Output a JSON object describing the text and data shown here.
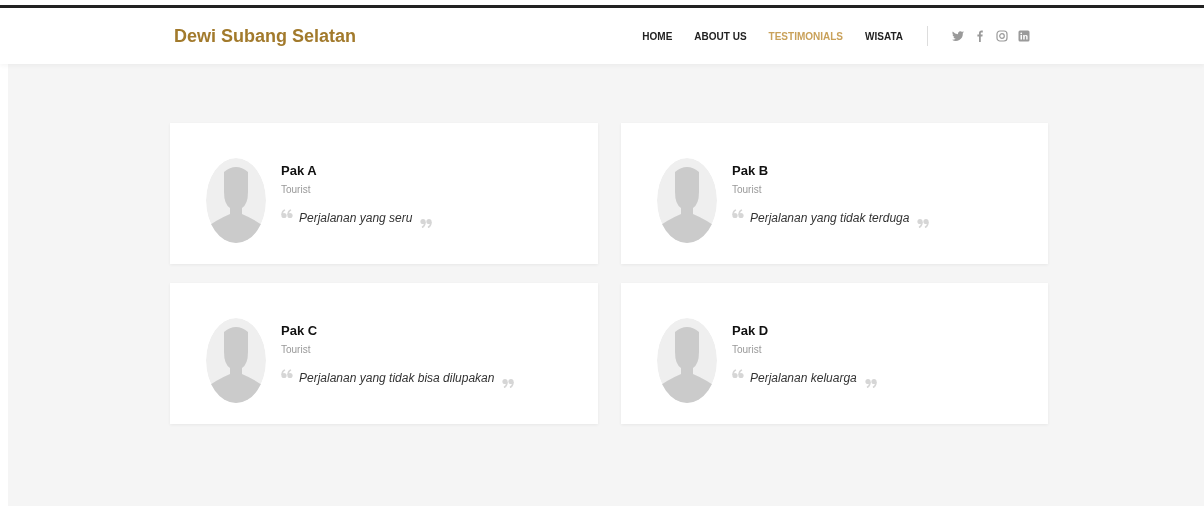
{
  "brand": "Dewi Subang Selatan",
  "nav": [
    {
      "label": "HOME",
      "selected": false
    },
    {
      "label": "ABOUT US",
      "selected": false
    },
    {
      "label": "TESTIMONIALS",
      "selected": true
    },
    {
      "label": "WISATA",
      "selected": false
    }
  ],
  "social": [
    {
      "kind": "twitter"
    },
    {
      "kind": "facebook"
    },
    {
      "kind": "instagram"
    },
    {
      "kind": "linkedin"
    }
  ],
  "testimonials": [
    {
      "name": "Pak A",
      "role": "Tourist",
      "quote": "Perjalanan yang seru"
    },
    {
      "name": "Pak B",
      "role": "Tourist",
      "quote": "Perjalanan yang tidak terduga"
    },
    {
      "name": "Pak C",
      "role": "Tourist",
      "quote": "Perjalanan yang tidak bisa dilupakan"
    },
    {
      "name": "Pak D",
      "role": "Tourist",
      "quote": "Perjalanan keluarga"
    }
  ]
}
